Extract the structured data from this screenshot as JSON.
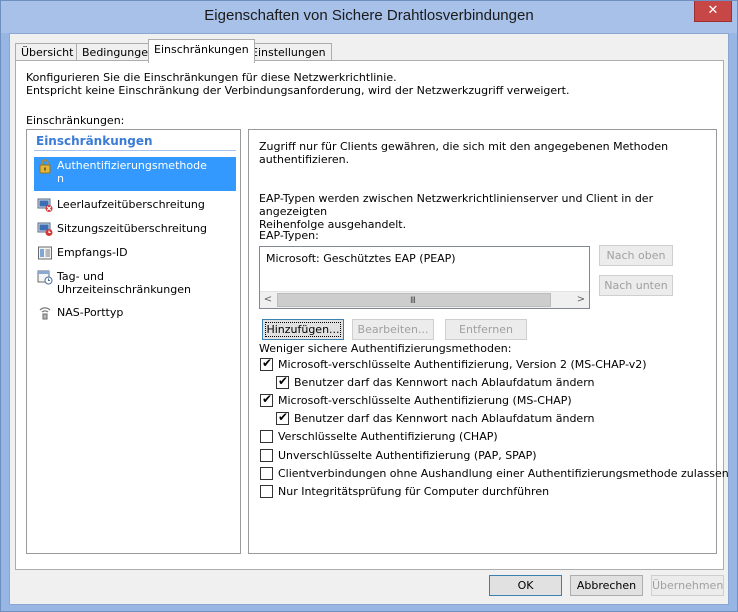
{
  "window": {
    "title": "Eigenschaften von Sichere Drahtlosverbindungen",
    "close_glyph": "✕"
  },
  "tabs": [
    {
      "label": "Übersicht"
    },
    {
      "label": "Bedingungen"
    },
    {
      "label": "Einschränkungen"
    },
    {
      "label": "Einstellungen"
    }
  ],
  "description": {
    "line1": "Konfigurieren Sie die Einschränkungen für diese Netzwerkrichtlinie.",
    "line2": "Entspricht keine Einschränkung der Verbindungsanforderung, wird der Netzwerkzugriff verweigert."
  },
  "restrictions_label": "Einschränkungen:",
  "left_panel": {
    "header": "Einschränkungen",
    "items": [
      {
        "label1": "Authentifizierungsmethode",
        "label2": "n",
        "icon": "lock-icon"
      },
      {
        "label1": "Leerlaufzeitüberschreitung",
        "icon": "idle-timeout-icon"
      },
      {
        "label1": "Sitzungszeitüberschreitung",
        "icon": "session-timeout-icon"
      },
      {
        "label1": "Empfangs-ID",
        "icon": "called-station-id-icon"
      },
      {
        "label1": "Tag- und",
        "label2": "Uhrzeiteinschränkungen",
        "icon": "calendar-clock-icon"
      },
      {
        "label1": "NAS-Porttyp",
        "icon": "nas-port-icon"
      }
    ]
  },
  "right_panel": {
    "intro1": "Zugriff nur für Clients gewähren, die sich mit den angegebenen Methoden",
    "intro2": "authentifizieren.",
    "eap_info1": "EAP-Typen werden zwischen Netzwerkrichtlinienserver und Client in der angezeigten",
    "eap_info2": "Reihenfolge ausgehandelt.",
    "eap_types_label": "EAP-Typen:",
    "eap_items": [
      "Microsoft: Geschütztes EAP (PEAP)"
    ],
    "scroll_left": "<",
    "scroll_right": ">",
    "scroll_grip": "III",
    "buttons": {
      "move_up": "Nach oben",
      "move_down": "Nach unten",
      "add": "Hinzufügen...",
      "edit": "Bearbeiten...",
      "remove": "Entfernen"
    },
    "less_secure_label": "Weniger sichere Authentifizierungsmethoden:",
    "checkboxes": [
      {
        "label": "Microsoft-verschlüsselte Authentifizierung, Version 2 (MS-CHAP-v2)",
        "checked": true
      },
      {
        "label": "Benutzer darf das Kennwort nach Ablaufdatum ändern",
        "checked": true
      },
      {
        "label": "Microsoft-verschlüsselte Authentifizierung (MS-CHAP)",
        "checked": true
      },
      {
        "label": "Benutzer darf das Kennwort nach Ablaufdatum ändern",
        "checked": true
      },
      {
        "label": "Verschlüsselte Authentifizierung (CHAP)",
        "checked": false
      },
      {
        "label": "Unverschlüsselte Authentifizierung (PAP, SPAP)",
        "checked": false
      },
      {
        "label": "Clientverbindungen ohne Aushandlung einer Authentifizierungsmethode zulassen",
        "checked": false
      },
      {
        "label": "Nur Integritätsprüfung für Computer durchführen",
        "checked": false
      }
    ],
    "check_glyph": "✔"
  },
  "footer": {
    "ok": "OK",
    "cancel": "Abbrechen",
    "apply": "Übernehmen"
  }
}
